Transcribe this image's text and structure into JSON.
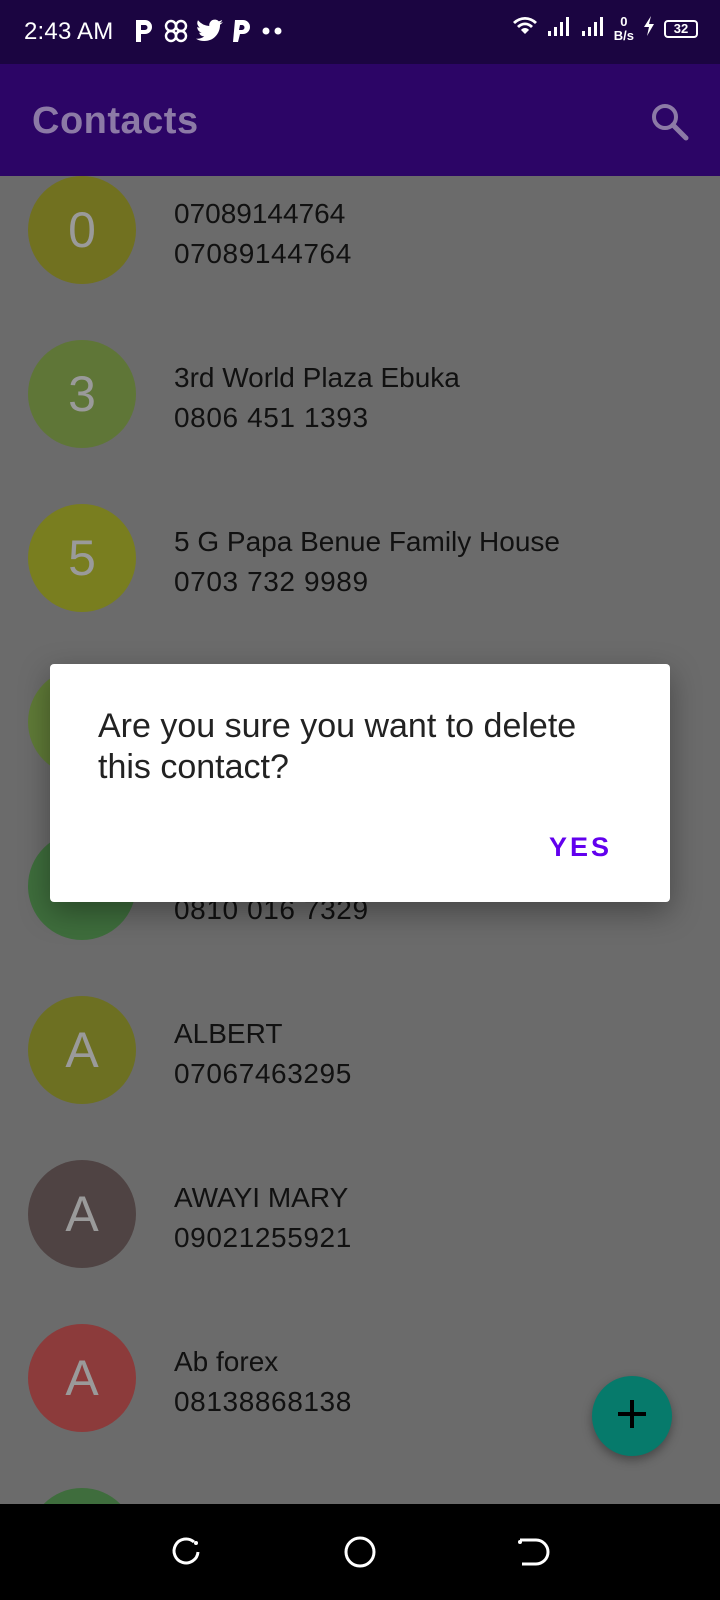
{
  "status_bar": {
    "time": "2:43 AM",
    "net_speed_value": "0",
    "net_speed_unit": "B/s",
    "battery": "32",
    "icons": [
      "p-app-icon",
      "pinwheel-icon",
      "twitter-icon",
      "p-app-icon",
      "more-dots-icon",
      "wifi-icon",
      "signal-icon",
      "signal-icon",
      "charging-icon",
      "battery-icon"
    ]
  },
  "app_bar": {
    "title": "Contacts",
    "search_icon": "search-icon"
  },
  "contacts": [
    {
      "letter": "0",
      "name": "07089144764",
      "phone": "07089144764",
      "avatar_color": "#717120"
    },
    {
      "letter": "3",
      "name": "3rd World Plaza Ebuka",
      "phone": "0806 451 1393",
      "avatar_color": "#5f7637"
    },
    {
      "letter": "5",
      "name": "5 G Papa Benue Family House",
      "phone": "0703 732 9989",
      "avatar_color": "#797e1f"
    },
    {
      "letter": "",
      "name": "",
      "phone": "",
      "avatar_color": "#5f7a37"
    },
    {
      "letter": "",
      "name": "",
      "phone": "0810 016 7329",
      "avatar_color": "#3e6d3c"
    },
    {
      "letter": "A",
      "name": "ALBERT",
      "phone": "07067463295",
      "avatar_color": "#6d7022"
    },
    {
      "letter": "A",
      "name": "AWAYI MARY",
      "phone": "09021255921",
      "avatar_color": "#4f4343"
    },
    {
      "letter": "A",
      "name": "Ab forex",
      "phone": "08138868138",
      "avatar_color": "#8c3b3b"
    },
    {
      "letter": "A",
      "name": "",
      "phone": "",
      "avatar_color": "#3f6d3d"
    }
  ],
  "dialog": {
    "message": "Are you sure you want to delete this contact?",
    "confirm_label": "YES"
  },
  "fab": {
    "icon": "plus-icon"
  },
  "nav_bar": {
    "icons": [
      "recent-apps-icon",
      "home-icon",
      "back-icon"
    ]
  }
}
